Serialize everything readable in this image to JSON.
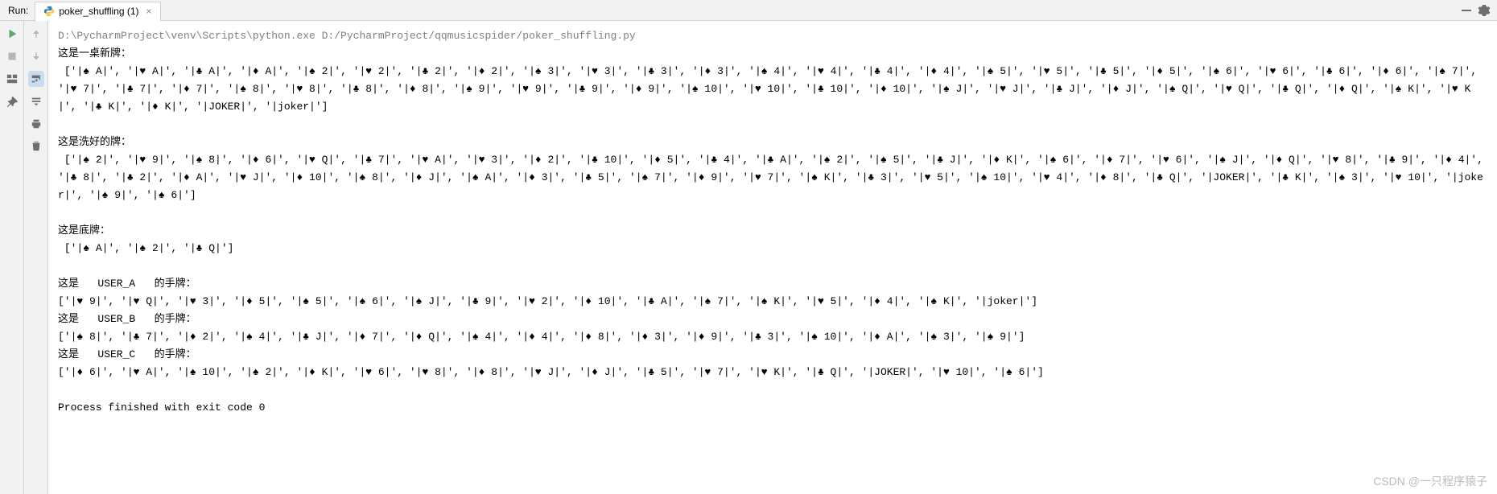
{
  "header": {
    "run_label": "Run:",
    "tab_title": "poker_shuffling (1)",
    "tab_close": "×"
  },
  "console": {
    "cmd_fragment": "D:\\PycharmProject\\venv\\Scripts\\python.exe D:/PycharmProject/qqmusicspider/poker_shuffling.py",
    "sec1_title": "这是一桌新牌：",
    "sec1_list": "['|♠ A|', '|♥ A|', '|♣ A|', '|♦ A|', '|♠ 2|', '|♥ 2|', '|♣ 2|', '|♦ 2|', '|♠ 3|', '|♥ 3|', '|♣ 3|', '|♦ 3|', '|♠ 4|', '|♥ 4|', '|♣ 4|', '|♦ 4|', '|♠ 5|', '|♥ 5|', '|♣ 5|', '|♦ 5|', '|♠ 6|', '|♥ 6|', '|♣ 6|', '|♦ 6|', '|♠ 7|', '|♥ 7|', '|♣ 7|', '|♦ 7|', '|♠ 8|', '|♥ 8|', '|♣ 8|', '|♦ 8|', '|♠ 9|', '|♥ 9|', '|♣ 9|', '|♦ 9|', '|♠ 10|', '|♥ 10|', '|♣ 10|', '|♦ 10|', '|♠ J|', '|♥ J|', '|♣ J|', '|♦ J|', '|♠ Q|', '|♥ Q|', '|♣ Q|', '|♦ Q|', '|♠ K|', '|♥ K|', '|♣ K|', '|♦ K|', '|JOKER|', '|joker|']",
    "sec2_title": "这是洗好的牌：",
    "sec2_list": "['|♠ 2|', '|♥ 9|', '|♠ 8|', '|♦ 6|', '|♥ Q|', '|♣ 7|', '|♥ A|', '|♥ 3|', '|♦ 2|', '|♣ 10|', '|♦ 5|', '|♣ 4|', '|♣ A|', '|♠ 2|', '|♠ 5|', '|♣ J|', '|♦ K|', '|♠ 6|', '|♦ 7|', '|♥ 6|', '|♠ J|', '|♦ Q|', '|♥ 8|', '|♣ 9|', '|♦ 4|', '|♣ 8|', '|♣ 2|', '|♦ A|', '|♥ J|', '|♦ 10|', '|♠ 8|', '|♦ J|', '|♠ A|', '|♦ 3|', '|♣ 5|', '|♠ 7|', '|♦ 9|', '|♥ 7|', '|♠ K|', '|♣ 3|', '|♥ 5|', '|♠ 10|', '|♥ 4|', '|♦ 8|', '|♣ Q|', '|JOKER|', '|♣ K|', '|♠ 3|', '|♥ 10|', '|joker|', '|♠ 9|', '|♠ 6|']",
    "sec3_title": "这是底牌：",
    "sec3_list": "['|♠ A|', '|♠ 2|', '|♣ Q|']",
    "userA_title": "这是   USER_A   的手牌：",
    "userA_list": "['|♥ 9|', '|♥ Q|', '|♥ 3|', '|♦ 5|', '|♠ 5|', '|♠ 6|', '|♠ J|', '|♣ 9|', '|♥ 2|', '|♦ 10|', '|♣ A|', '|♠ 7|', '|♠ K|', '|♥ 5|', '|♦ 4|', '|♠ K|', '|joker|']",
    "userB_title": "这是   USER_B   的手牌：",
    "userB_list": "['|♠ 8|', '|♣ 7|', '|♦ 2|', '|♠ 4|', '|♣ J|', '|♦ 7|', '|♦ Q|', '|♠ 4|', '|♦ 4|', '|♦ 8|', '|♦ 3|', '|♦ 9|', '|♣ 3|', '|♠ 10|', '|♦ A|', '|♠ 3|', '|♠ 9|']",
    "userC_title": "这是   USER_C   的手牌：",
    "userC_list": "['|♦ 6|', '|♥ A|', '|♠ 10|', '|♠ 2|', '|♦ K|', '|♥ 6|', '|♥ 8|', '|♦ 8|', '|♥ J|', '|♦ J|', '|♣ 5|', '|♥ 7|', '|♥ K|', '|♣ Q|', '|JOKER|', '|♥ 10|', '|♠ 6|']",
    "exit_line": "Process finished with exit code 0"
  },
  "watermark": "CSDN @一只程序猿子"
}
